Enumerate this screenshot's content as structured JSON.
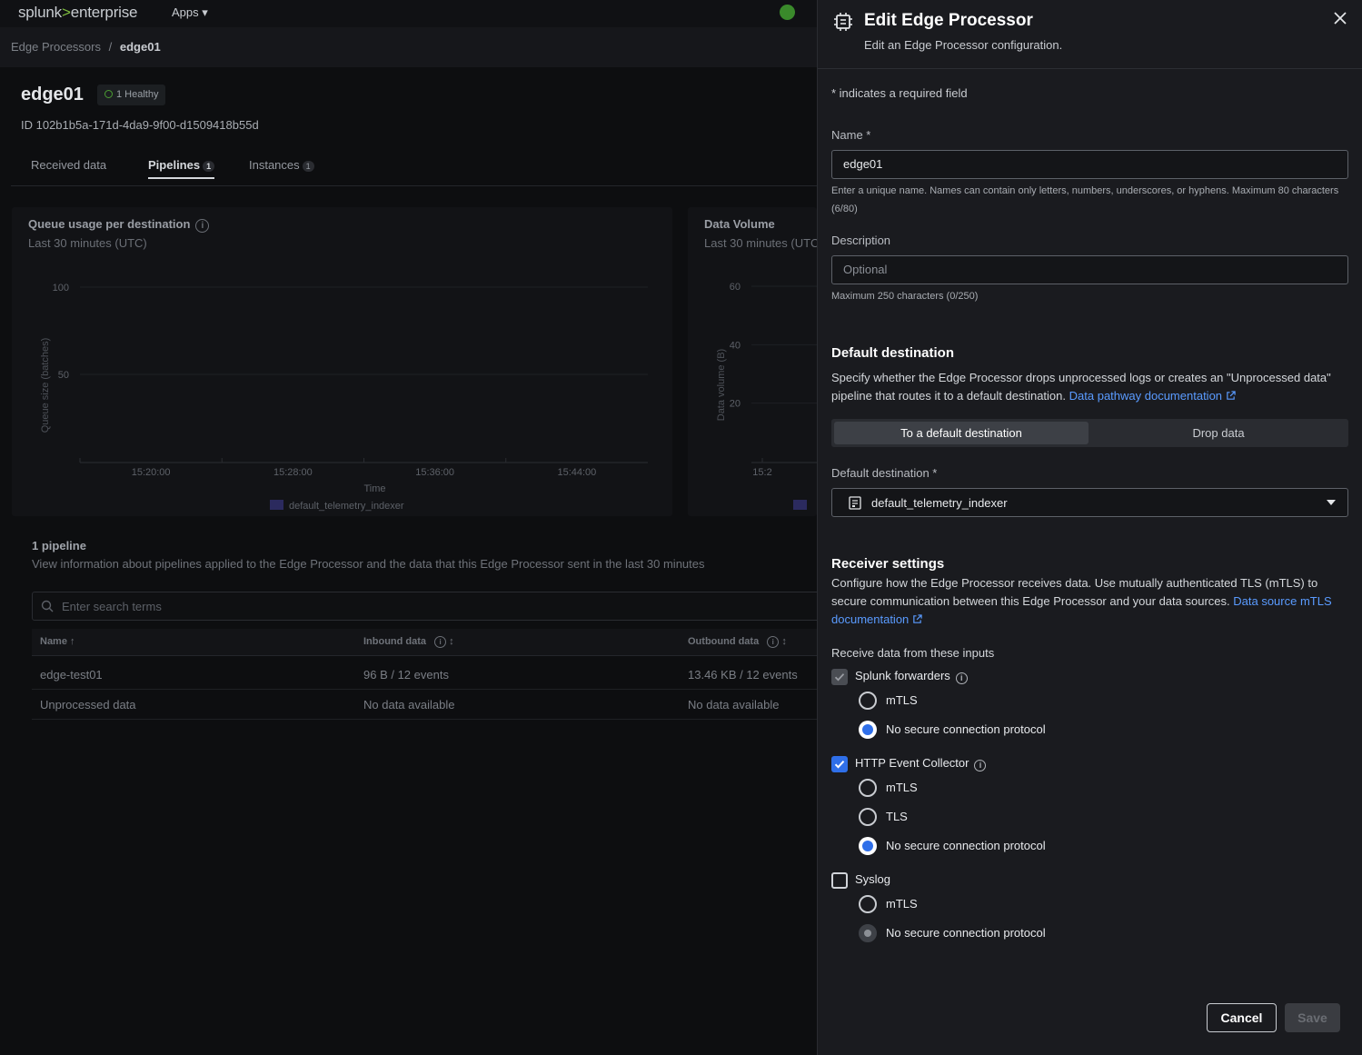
{
  "background": {
    "brand": {
      "splunk": "splunk",
      "sep": ">",
      "enterprise": "enterprise"
    },
    "apps_menu": "Apps",
    "breadcrumb": {
      "parent": "Edge Processors",
      "separator": "/",
      "current": "edge01"
    },
    "title": "edge01",
    "health_badge": "1 Healthy",
    "id_line": "ID 102b1b5a-171d-4da9-9f00-d1509418b55d",
    "tabs": [
      {
        "label": "Received data",
        "count": ""
      },
      {
        "label": "Pipelines",
        "count": "1"
      },
      {
        "label": "Instances",
        "count": "1"
      }
    ],
    "queue_panel": {
      "title": "Queue usage per destination",
      "subtitle": "Last 30 minutes (UTC)"
    },
    "volume_panel": {
      "title": "Data Volume",
      "subtitle": "Last 30 minutes (UTC)"
    },
    "pipelines": {
      "title": "1 pipeline",
      "description": "View information about pipelines applied to the Edge Processor and the data that this Edge Processor sent in the last 30 minutes",
      "search_placeholder": "Enter search terms",
      "columns": [
        "Name ↑",
        "Inbound data",
        "Outbound data"
      ],
      "rows": [
        [
          "edge-test01",
          "96 B / 12 events",
          "13.46 KB / 12 events"
        ],
        [
          "Unprocessed data",
          "No data available",
          "No data available"
        ]
      ]
    }
  },
  "chart_data": [
    {
      "type": "line",
      "title": "Queue usage per destination",
      "subtitle": "Last 30 minutes (UTC)",
      "xlabel": "Time",
      "ylabel": "Queue size (batches)",
      "x_ticks": [
        "15:20:00",
        "15:28:00",
        "15:36:00",
        "15:44:00"
      ],
      "y_ticks": [
        100,
        50
      ],
      "ylim": [
        0,
        100
      ],
      "series": [
        {
          "name": "default_telemetry_indexer",
          "values": []
        }
      ],
      "legend": "bottom",
      "color": "#2b2a5e"
    },
    {
      "type": "line",
      "title": "Data Volume",
      "subtitle": "Last 30 minutes (UTC)",
      "ylabel": "Data volume (B)",
      "x_ticks": [
        "15:2"
      ],
      "y_ticks": [
        60,
        40,
        20
      ],
      "ylim": [
        0,
        60
      ],
      "series": [
        {
          "values": []
        }
      ],
      "legend": "bottom",
      "color": "#2b2a5e"
    }
  ],
  "drawer": {
    "title": "Edit Edge Processor",
    "subtitle": "Edit an Edge Processor configuration.",
    "required_note": "* indicates a required field",
    "name": {
      "label": "Name *",
      "value": "edge01",
      "help": "Enter a unique name. Names can contain only letters, numbers, underscores, or hyphens. Maximum 80 characters (6/80)"
    },
    "description": {
      "label": "Description",
      "placeholder": "Optional",
      "help": "Maximum 250 characters (0/250)"
    },
    "default_destination": {
      "section_title": "Default destination",
      "text": "Specify whether the Edge Processor drops unprocessed logs or creates an \"Unprocessed data\" pipeline that routes it to a default destination.",
      "link": "Data pathway documentation",
      "options": [
        "To a default destination",
        "Drop data"
      ],
      "selected_option": "To a default destination",
      "select_label": "Default destination *",
      "select_value": "default_telemetry_indexer"
    },
    "receiver": {
      "section_title": "Receiver settings",
      "text": "Configure how the Edge Processor receives data. Use mutually authenticated TLS (mTLS) to secure communication between this Edge Processor and your data sources.",
      "link": "Data source mTLS documentation",
      "inputs_label": "Receive data from these inputs",
      "inputs": [
        {
          "label": "Splunk forwarders",
          "checked": true,
          "disabled": true,
          "options": [
            "mTLS",
            "No secure connection protocol"
          ],
          "selected": "No secure connection protocol"
        },
        {
          "label": "HTTP Event Collector",
          "checked": true,
          "disabled": false,
          "options": [
            "mTLS",
            "TLS",
            "No secure connection protocol"
          ],
          "selected": "No secure connection protocol"
        },
        {
          "label": "Syslog",
          "checked": false,
          "disabled": false,
          "options": [
            "mTLS",
            "No secure connection protocol"
          ],
          "selected": "No secure connection protocol"
        }
      ]
    },
    "buttons": {
      "cancel": "Cancel",
      "save": "Save"
    },
    "colors": {
      "accent": "#2f6fe9",
      "link": "#5a9bff",
      "drawer_bg": "#1a1b1f"
    }
  }
}
